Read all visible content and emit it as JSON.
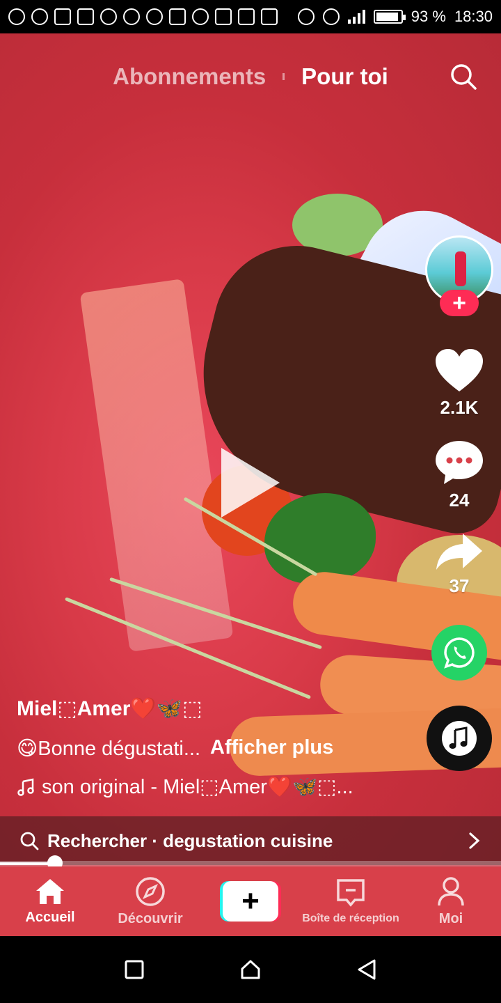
{
  "status_bar": {
    "battery": "93 %",
    "battery_level": 0.93,
    "time": "18:30"
  },
  "top_nav": {
    "tabs": [
      "Abonnements",
      "Pour toi"
    ],
    "active_tab": "Pour toi",
    "search_icon": "search-icon"
  },
  "actions": {
    "likes": "2.1K",
    "comments": "24",
    "shares": "37",
    "follow_label": "+"
  },
  "caption": {
    "username": "Miel⬚Amer❤️🦋⬚",
    "description": "😋Bonne dégustati...",
    "more": "Afficher plus",
    "sound": "son original - Miel⬚Amer❤️🦋⬚..."
  },
  "search_bar": {
    "label": "Rechercher · degustation cuisine"
  },
  "progress": {
    "fraction": 0.11
  },
  "tab_bar": {
    "home": "Accueil",
    "discover": "Découvrir",
    "create": "+",
    "inbox": "Boîte de réception",
    "me": "Moi",
    "active": "home"
  },
  "colors": {
    "accent": "#fe2c55",
    "cyan": "#25f4ee",
    "whatsapp": "#25d366",
    "tabbar": "#d8404a"
  }
}
